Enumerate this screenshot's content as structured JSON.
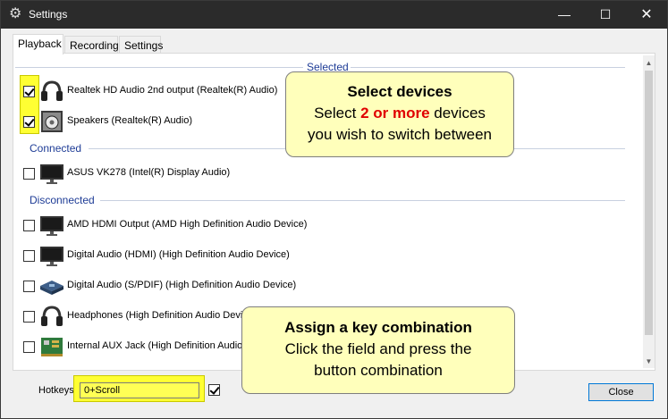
{
  "window": {
    "title": "Settings",
    "buttons": {
      "minimize": "—",
      "maximize": "☐",
      "close": "✕"
    }
  },
  "tabs": [
    {
      "label": "Playback",
      "active": true
    },
    {
      "label": "Recording",
      "active": false
    },
    {
      "label": "Settings",
      "active": false
    }
  ],
  "groups": {
    "selected": "Selected",
    "connected": "Connected",
    "disconnected": "Disconnected"
  },
  "devices": [
    {
      "name": "Realtek HD Audio 2nd output (Realtek(R) Audio)",
      "checked": true,
      "icon": "headphones-icon",
      "group": "selected"
    },
    {
      "name": "Speakers (Realtek(R) Audio)",
      "checked": true,
      "icon": "speaker-icon",
      "group": "selected"
    },
    {
      "name": "ASUS VK278 (Intel(R) Display Audio)",
      "checked": false,
      "icon": "monitor-icon",
      "group": "connected"
    },
    {
      "name": "AMD HDMI Output (AMD High Definition Audio Device)",
      "checked": false,
      "icon": "monitor-icon",
      "group": "disconnected"
    },
    {
      "name": "Digital Audio (HDMI) (High Definition Audio Device)",
      "checked": false,
      "icon": "monitor-icon",
      "group": "disconnected"
    },
    {
      "name": "Digital Audio (S/PDIF) (High Definition Audio Device)",
      "checked": false,
      "icon": "spdif-icon",
      "group": "disconnected"
    },
    {
      "name": "Headphones (High Definition Audio Device)",
      "checked": false,
      "icon": "headphones-icon",
      "group": "disconnected"
    },
    {
      "name": "Internal AUX Jack (High Definition Audio Device)",
      "checked": false,
      "icon": "circuit-board-icon",
      "group": "disconnected"
    }
  ],
  "callouts": {
    "select": {
      "title": "Select devices",
      "line1_pre": "Select ",
      "line1_em": "2 or more",
      "line1_post": " devices",
      "line2": "you wish to switch between"
    },
    "assign": {
      "title": "Assign a key combination",
      "line1": "Click the field and press the",
      "line2": "button combination"
    }
  },
  "footer": {
    "hotkeys_label": "Hotkeys",
    "hotkey_value": "0+Scroll",
    "hotkey_enabled": true,
    "close_label": "Close"
  },
  "colors": {
    "titlebar": "#2b2b2b",
    "group_header": "#1e3c96",
    "highlight": "#ffff33",
    "callout_bg": "#ffffbb",
    "emphasis": "#e00000",
    "focus_border": "#0078d7"
  }
}
